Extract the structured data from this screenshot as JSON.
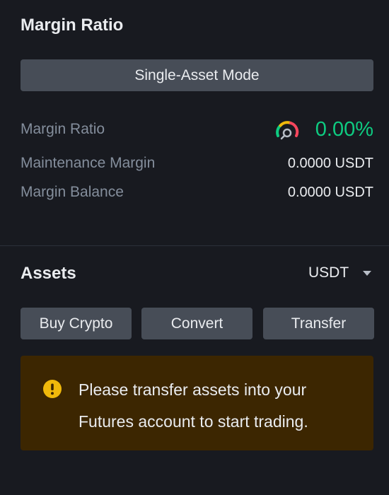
{
  "margin_section": {
    "title": "Margin Ratio",
    "mode_button": "Single-Asset Mode",
    "ratio_label": "Margin Ratio",
    "ratio_value": "0.00%",
    "ratio_icon": "gauge-icon",
    "maintenance_label": "Maintenance Margin",
    "maintenance_value": "0.0000 USDT",
    "balance_label": "Margin Balance",
    "balance_value": "0.0000 USDT"
  },
  "assets_section": {
    "title": "Assets",
    "currency": "USDT",
    "buttons": {
      "buy_crypto": "Buy Crypto",
      "convert": "Convert",
      "transfer": "Transfer"
    },
    "notice": {
      "icon": "warning-icon",
      "text": "Please transfer assets into your Futures account to start trading."
    }
  },
  "colors": {
    "background": "#181a20",
    "button_bg": "#474d57",
    "positive": "#0ecb81",
    "notice_bg": "#3c2601",
    "warning": "#f0b90b"
  }
}
